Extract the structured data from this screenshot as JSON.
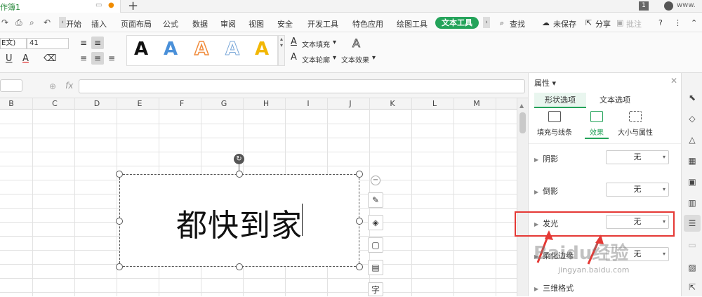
{
  "titlebar": {
    "doc_name": "作簿1",
    "page_badge": "1",
    "site": "www."
  },
  "menu": {
    "start": "开始",
    "insert": "插入",
    "layout": "页面布局",
    "formula": "公式",
    "data": "数据",
    "review": "审阅",
    "view": "视图",
    "security": "安全",
    "dev": "开发工具",
    "special": "特色应用",
    "drawing": "绘图工具",
    "text_tool": "文本工具",
    "search": "查找",
    "unsaved": "未保存",
    "share": "分享",
    "comment": "批注"
  },
  "ribbon": {
    "font_name": "E文)",
    "font_size": "41",
    "style_letter": "A",
    "text_fill": "文本填充",
    "text_outline": "文本轮廓",
    "text_effect": "文本效果"
  },
  "colors": {
    "accent": "#24a35a",
    "annotation": "#e53935"
  },
  "grid": {
    "columns": [
      "B",
      "C",
      "D",
      "E",
      "F",
      "G",
      "H",
      "I",
      "J",
      "K",
      "L",
      "M"
    ]
  },
  "textbox": {
    "content": "都快到家"
  },
  "panel": {
    "title": "属性",
    "tab_shape": "形状选项",
    "tab_text": "文本选项",
    "sub_fill": "填充与线条",
    "sub_effect": "效果",
    "sub_size": "大小与属性",
    "rows": [
      {
        "label": "阴影",
        "value": "无"
      },
      {
        "label": "倒影",
        "value": "无"
      },
      {
        "label": "发光",
        "value": "无"
      },
      {
        "label": "柔化边缘",
        "value": "无"
      }
    ],
    "row_3d": "三维格式"
  },
  "watermark": {
    "brand": "Baidu经验",
    "url": "jingyan.baidu.com"
  }
}
